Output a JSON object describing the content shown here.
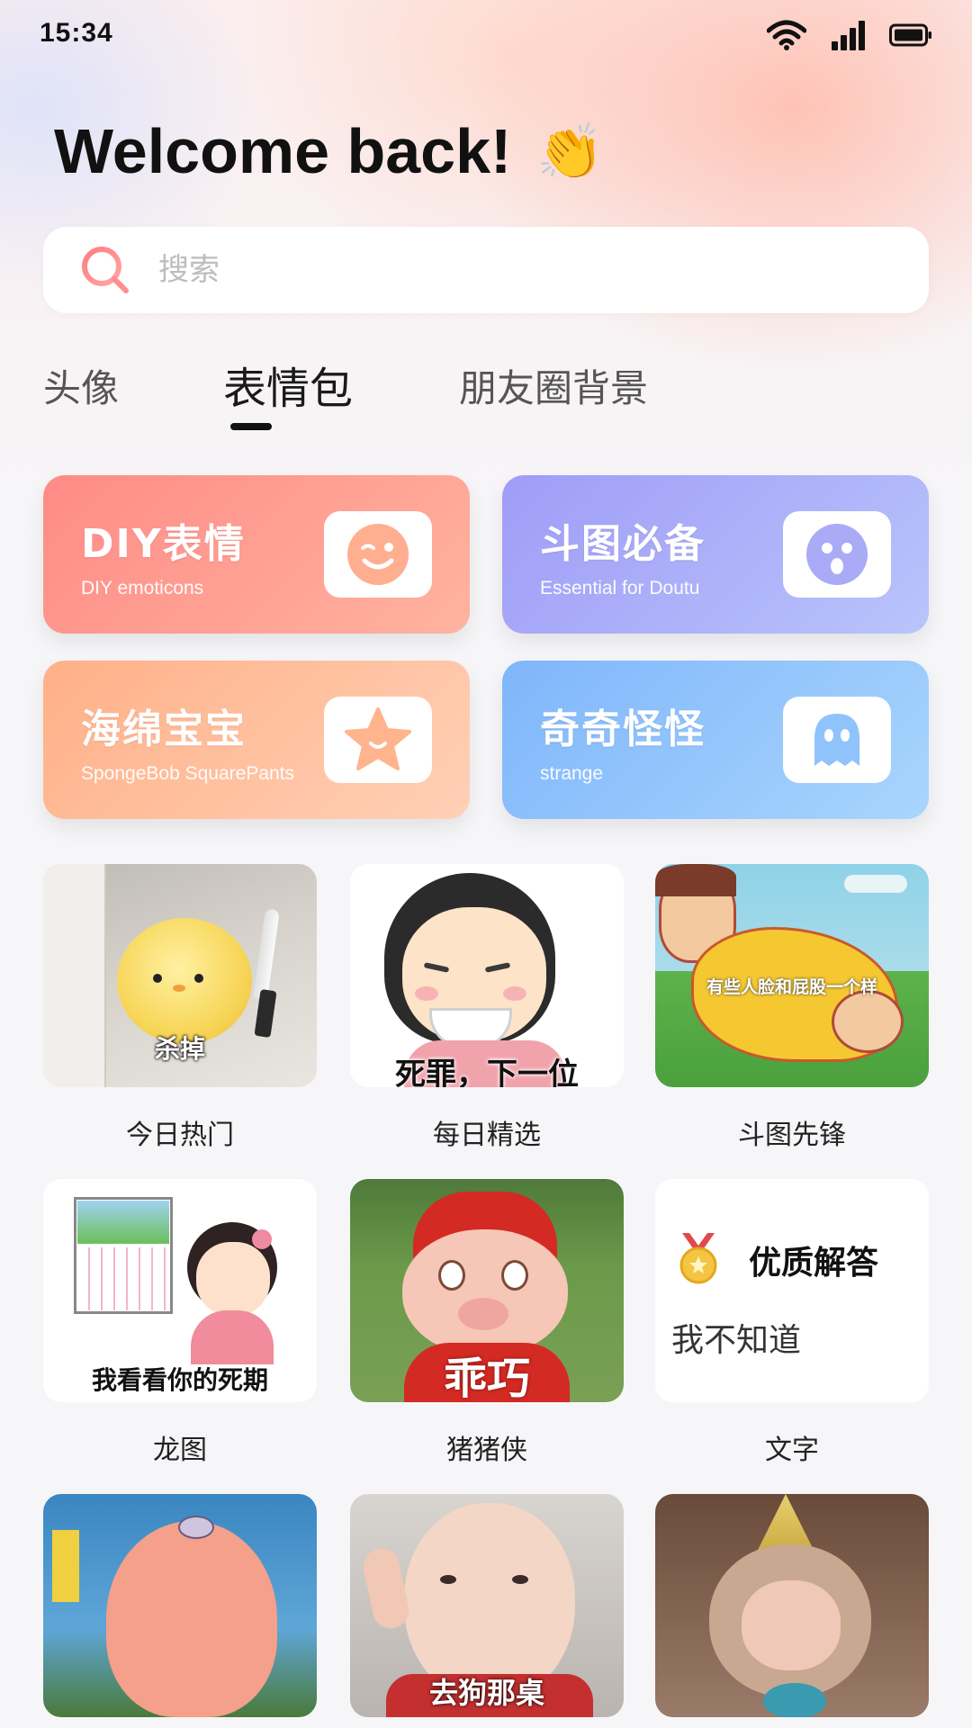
{
  "status_bar": {
    "time": "15:34",
    "icons": [
      "wifi-icon",
      "signal-icon",
      "battery-icon"
    ]
  },
  "welcome": {
    "text": "Welcome back!",
    "emoji": "👏"
  },
  "search": {
    "placeholder": "搜索",
    "value": ""
  },
  "tabs": [
    {
      "label": "头像",
      "active": false
    },
    {
      "label": "表情包",
      "active": true
    },
    {
      "label": "朋友圈背景",
      "active": false
    }
  ],
  "categories": [
    {
      "title": "DIY表情",
      "subtitle": "DIY emoticons",
      "icon": "wink-face-icon",
      "color": "#ff8b86"
    },
    {
      "title": "斗图必备",
      "subtitle": "Essential for Doutu",
      "icon": "surprised-face-icon",
      "color": "#9f9cf7"
    },
    {
      "title": "海绵宝宝",
      "subtitle": "SpongeBob SquarePants",
      "icon": "star-face-icon",
      "color": "#ffb087"
    },
    {
      "title": "奇奇怪怪",
      "subtitle": "strange",
      "icon": "ghost-icon",
      "color": "#7fb6fb"
    }
  ],
  "grid": [
    {
      "label": "今日热门",
      "caption": "杀掉"
    },
    {
      "label": "每日精选",
      "caption": "死罪，下一位"
    },
    {
      "label": "斗图先锋",
      "caption": "有些人脸和屁股一个样"
    },
    {
      "label": "龙图",
      "caption": "我看看你的死期"
    },
    {
      "label": "猪猪侠",
      "caption": "乖巧"
    },
    {
      "label": "文字",
      "caption_title": "优质解答",
      "caption": "我不知道"
    },
    {
      "label": "",
      "caption": ""
    },
    {
      "label": "",
      "caption": "去狗那桌"
    },
    {
      "label": "",
      "caption": ""
    }
  ]
}
